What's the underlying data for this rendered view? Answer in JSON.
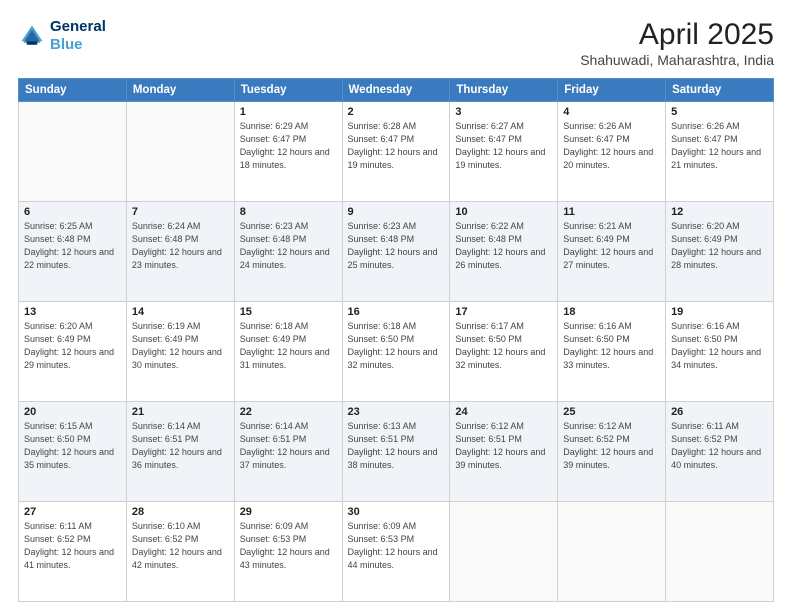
{
  "header": {
    "logo_line1": "General",
    "logo_line2": "Blue",
    "title": "April 2025",
    "subtitle": "Shahuwadi, Maharashtra, India"
  },
  "weekdays": [
    "Sunday",
    "Monday",
    "Tuesday",
    "Wednesday",
    "Thursday",
    "Friday",
    "Saturday"
  ],
  "weeks": [
    [
      {
        "day": "",
        "sunrise": "",
        "sunset": "",
        "daylight": ""
      },
      {
        "day": "",
        "sunrise": "",
        "sunset": "",
        "daylight": ""
      },
      {
        "day": "1",
        "sunrise": "Sunrise: 6:29 AM",
        "sunset": "Sunset: 6:47 PM",
        "daylight": "Daylight: 12 hours and 18 minutes."
      },
      {
        "day": "2",
        "sunrise": "Sunrise: 6:28 AM",
        "sunset": "Sunset: 6:47 PM",
        "daylight": "Daylight: 12 hours and 19 minutes."
      },
      {
        "day": "3",
        "sunrise": "Sunrise: 6:27 AM",
        "sunset": "Sunset: 6:47 PM",
        "daylight": "Daylight: 12 hours and 19 minutes."
      },
      {
        "day": "4",
        "sunrise": "Sunrise: 6:26 AM",
        "sunset": "Sunset: 6:47 PM",
        "daylight": "Daylight: 12 hours and 20 minutes."
      },
      {
        "day": "5",
        "sunrise": "Sunrise: 6:26 AM",
        "sunset": "Sunset: 6:47 PM",
        "daylight": "Daylight: 12 hours and 21 minutes."
      }
    ],
    [
      {
        "day": "6",
        "sunrise": "Sunrise: 6:25 AM",
        "sunset": "Sunset: 6:48 PM",
        "daylight": "Daylight: 12 hours and 22 minutes."
      },
      {
        "day": "7",
        "sunrise": "Sunrise: 6:24 AM",
        "sunset": "Sunset: 6:48 PM",
        "daylight": "Daylight: 12 hours and 23 minutes."
      },
      {
        "day": "8",
        "sunrise": "Sunrise: 6:23 AM",
        "sunset": "Sunset: 6:48 PM",
        "daylight": "Daylight: 12 hours and 24 minutes."
      },
      {
        "day": "9",
        "sunrise": "Sunrise: 6:23 AM",
        "sunset": "Sunset: 6:48 PM",
        "daylight": "Daylight: 12 hours and 25 minutes."
      },
      {
        "day": "10",
        "sunrise": "Sunrise: 6:22 AM",
        "sunset": "Sunset: 6:48 PM",
        "daylight": "Daylight: 12 hours and 26 minutes."
      },
      {
        "day": "11",
        "sunrise": "Sunrise: 6:21 AM",
        "sunset": "Sunset: 6:49 PM",
        "daylight": "Daylight: 12 hours and 27 minutes."
      },
      {
        "day": "12",
        "sunrise": "Sunrise: 6:20 AM",
        "sunset": "Sunset: 6:49 PM",
        "daylight": "Daylight: 12 hours and 28 minutes."
      }
    ],
    [
      {
        "day": "13",
        "sunrise": "Sunrise: 6:20 AM",
        "sunset": "Sunset: 6:49 PM",
        "daylight": "Daylight: 12 hours and 29 minutes."
      },
      {
        "day": "14",
        "sunrise": "Sunrise: 6:19 AM",
        "sunset": "Sunset: 6:49 PM",
        "daylight": "Daylight: 12 hours and 30 minutes."
      },
      {
        "day": "15",
        "sunrise": "Sunrise: 6:18 AM",
        "sunset": "Sunset: 6:49 PM",
        "daylight": "Daylight: 12 hours and 31 minutes."
      },
      {
        "day": "16",
        "sunrise": "Sunrise: 6:18 AM",
        "sunset": "Sunset: 6:50 PM",
        "daylight": "Daylight: 12 hours and 32 minutes."
      },
      {
        "day": "17",
        "sunrise": "Sunrise: 6:17 AM",
        "sunset": "Sunset: 6:50 PM",
        "daylight": "Daylight: 12 hours and 32 minutes."
      },
      {
        "day": "18",
        "sunrise": "Sunrise: 6:16 AM",
        "sunset": "Sunset: 6:50 PM",
        "daylight": "Daylight: 12 hours and 33 minutes."
      },
      {
        "day": "19",
        "sunrise": "Sunrise: 6:16 AM",
        "sunset": "Sunset: 6:50 PM",
        "daylight": "Daylight: 12 hours and 34 minutes."
      }
    ],
    [
      {
        "day": "20",
        "sunrise": "Sunrise: 6:15 AM",
        "sunset": "Sunset: 6:50 PM",
        "daylight": "Daylight: 12 hours and 35 minutes."
      },
      {
        "day": "21",
        "sunrise": "Sunrise: 6:14 AM",
        "sunset": "Sunset: 6:51 PM",
        "daylight": "Daylight: 12 hours and 36 minutes."
      },
      {
        "day": "22",
        "sunrise": "Sunrise: 6:14 AM",
        "sunset": "Sunset: 6:51 PM",
        "daylight": "Daylight: 12 hours and 37 minutes."
      },
      {
        "day": "23",
        "sunrise": "Sunrise: 6:13 AM",
        "sunset": "Sunset: 6:51 PM",
        "daylight": "Daylight: 12 hours and 38 minutes."
      },
      {
        "day": "24",
        "sunrise": "Sunrise: 6:12 AM",
        "sunset": "Sunset: 6:51 PM",
        "daylight": "Daylight: 12 hours and 39 minutes."
      },
      {
        "day": "25",
        "sunrise": "Sunrise: 6:12 AM",
        "sunset": "Sunset: 6:52 PM",
        "daylight": "Daylight: 12 hours and 39 minutes."
      },
      {
        "day": "26",
        "sunrise": "Sunrise: 6:11 AM",
        "sunset": "Sunset: 6:52 PM",
        "daylight": "Daylight: 12 hours and 40 minutes."
      }
    ],
    [
      {
        "day": "27",
        "sunrise": "Sunrise: 6:11 AM",
        "sunset": "Sunset: 6:52 PM",
        "daylight": "Daylight: 12 hours and 41 minutes."
      },
      {
        "day": "28",
        "sunrise": "Sunrise: 6:10 AM",
        "sunset": "Sunset: 6:52 PM",
        "daylight": "Daylight: 12 hours and 42 minutes."
      },
      {
        "day": "29",
        "sunrise": "Sunrise: 6:09 AM",
        "sunset": "Sunset: 6:53 PM",
        "daylight": "Daylight: 12 hours and 43 minutes."
      },
      {
        "day": "30",
        "sunrise": "Sunrise: 6:09 AM",
        "sunset": "Sunset: 6:53 PM",
        "daylight": "Daylight: 12 hours and 44 minutes."
      },
      {
        "day": "",
        "sunrise": "",
        "sunset": "",
        "daylight": ""
      },
      {
        "day": "",
        "sunrise": "",
        "sunset": "",
        "daylight": ""
      },
      {
        "day": "",
        "sunrise": "",
        "sunset": "",
        "daylight": ""
      }
    ]
  ]
}
